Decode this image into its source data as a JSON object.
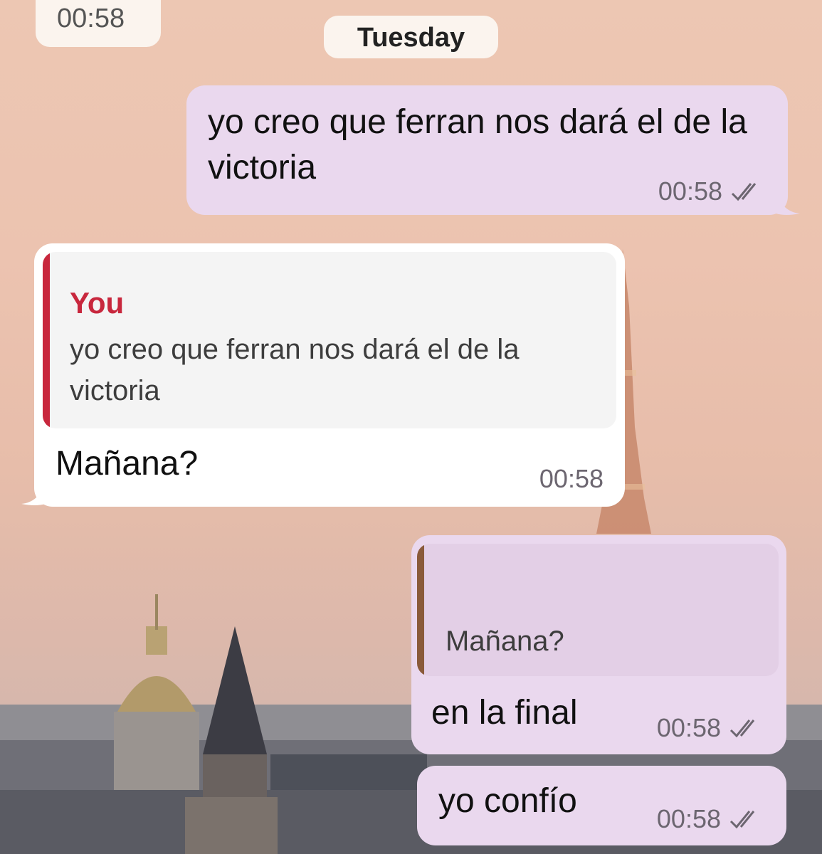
{
  "top_time": "00:58",
  "date_divider": "Tuesday",
  "messages": [
    {
      "text": "yo creo que ferran nos dará el de la victoria",
      "time": "00:58"
    },
    {
      "quote_author": "You",
      "quote_text": "yo creo que ferran nos dará el de la victoria",
      "text": "Mañana?",
      "time": "00:58"
    },
    {
      "quote_text": "Mañana?",
      "text": "en la final",
      "time": "00:58"
    },
    {
      "text": "yo confío",
      "time": "00:58"
    }
  ],
  "colors": {
    "outgoing": "#ead8ee",
    "incoming": "#ffffff",
    "quote_author": "#c8273d",
    "quote_bar_outgoing": "#8a5a3a"
  },
  "icons": {
    "read_receipt": "double-check-icon"
  }
}
